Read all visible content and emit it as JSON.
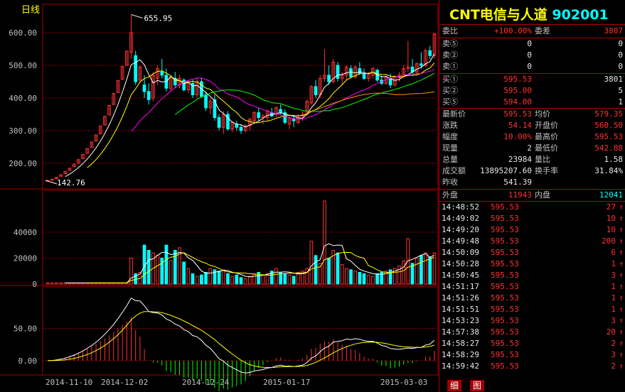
{
  "chart": {
    "period_label": "日线",
    "price_axis": [
      "600.00",
      "500.00",
      "400.00",
      "300.00",
      "200.00"
    ],
    "volume_axis": [
      "40000",
      "20000",
      "0"
    ],
    "macd_axis": [
      "50.00",
      "0.00"
    ],
    "high_marker": "655.95",
    "low_marker": "142.76",
    "dates": [
      "2014-11-10",
      "2014-12-02",
      "2014-12-24",
      "2015-01-17",
      "2015-03-03"
    ],
    "colors": {
      "up": "#ff3232",
      "down": "#00ffff",
      "grid": "#a00000",
      "ma5": "#ffffff",
      "ma10": "#ffff00",
      "ma20": "#ff00ff",
      "ma30": "#00ff00",
      "ma60": "#ff8c00"
    }
  },
  "chart_data": {
    "type": "candlestick",
    "price_ylim": [
      130,
      670
    ],
    "volume_ylim": [
      0,
      70000
    ],
    "macd_ylim": [
      -20,
      110
    ],
    "candles": [
      [
        145,
        148,
        143,
        147
      ],
      [
        148,
        152,
        146,
        151
      ],
      [
        153,
        158,
        151,
        157
      ],
      [
        160,
        166,
        158,
        165
      ],
      [
        168,
        176,
        167,
        175
      ],
      [
        178,
        186,
        177,
        185
      ],
      [
        189,
        198,
        188,
        197
      ],
      [
        200,
        212,
        199,
        211
      ],
      [
        214,
        228,
        213,
        227
      ],
      [
        230,
        246,
        229,
        245
      ],
      [
        248,
        266,
        247,
        265
      ],
      [
        268,
        288,
        267,
        287
      ],
      [
        290,
        315,
        289,
        314
      ],
      [
        317,
        345,
        316,
        344
      ],
      [
        348,
        378,
        347,
        377
      ],
      [
        380,
        415,
        379,
        414
      ],
      [
        417,
        455,
        416,
        454
      ],
      [
        457,
        498,
        456,
        497
      ],
      [
        500,
        545,
        499,
        544
      ],
      [
        540,
        656,
        520,
        600
      ],
      [
        530,
        545,
        440,
        450
      ],
      [
        455,
        500,
        450,
        495
      ],
      [
        440,
        470,
        400,
        420
      ],
      [
        420,
        445,
        380,
        395
      ],
      [
        400,
        480,
        390,
        470
      ],
      [
        460,
        500,
        440,
        490
      ],
      [
        480,
        520,
        460,
        470
      ],
      [
        470,
        490,
        420,
        430
      ],
      [
        430,
        470,
        420,
        465
      ],
      [
        460,
        480,
        430,
        440
      ],
      [
        440,
        470,
        430,
        460
      ],
      [
        455,
        460,
        420,
        425
      ],
      [
        425,
        455,
        415,
        450
      ],
      [
        445,
        455,
        400,
        410
      ],
      [
        410,
        460,
        400,
        450
      ],
      [
        450,
        460,
        400,
        405
      ],
      [
        410,
        420,
        360,
        370
      ],
      [
        370,
        400,
        350,
        390
      ],
      [
        395,
        410,
        330,
        340
      ],
      [
        340,
        350,
        300,
        310
      ],
      [
        310,
        360,
        290,
        350
      ],
      [
        350,
        360,
        300,
        305
      ],
      [
        305,
        330,
        295,
        325
      ],
      [
        320,
        330,
        300,
        310
      ],
      [
        310,
        320,
        290,
        300
      ],
      [
        300,
        320,
        295,
        315
      ],
      [
        315,
        340,
        300,
        335
      ],
      [
        330,
        360,
        320,
        355
      ],
      [
        355,
        370,
        330,
        340
      ],
      [
        340,
        350,
        320,
        345
      ],
      [
        340,
        365,
        330,
        360
      ],
      [
        355,
        370,
        340,
        345
      ],
      [
        350,
        375,
        340,
        370
      ],
      [
        365,
        380,
        350,
        355
      ],
      [
        355,
        365,
        320,
        325
      ],
      [
        320,
        345,
        305,
        340
      ],
      [
        335,
        345,
        310,
        330
      ],
      [
        325,
        350,
        320,
        345
      ],
      [
        345,
        360,
        330,
        350
      ],
      [
        350,
        395,
        345,
        390
      ],
      [
        385,
        440,
        380,
        435
      ],
      [
        435,
        455,
        400,
        410
      ],
      [
        410,
        470,
        400,
        460
      ],
      [
        460,
        550,
        450,
        470
      ],
      [
        470,
        500,
        440,
        450
      ],
      [
        450,
        520,
        445,
        510
      ],
      [
        500,
        510,
        450,
        460
      ],
      [
        460,
        480,
        440,
        470
      ],
      [
        470,
        500,
        455,
        495
      ],
      [
        490,
        500,
        460,
        465
      ],
      [
        465,
        500,
        460,
        495
      ],
      [
        490,
        510,
        470,
        475
      ],
      [
        475,
        490,
        455,
        460
      ],
      [
        460,
        480,
        450,
        475
      ],
      [
        470,
        495,
        460,
        490
      ],
      [
        485,
        490,
        450,
        455
      ],
      [
        455,
        470,
        440,
        445
      ],
      [
        445,
        470,
        440,
        465
      ],
      [
        460,
        475,
        430,
        440
      ],
      [
        440,
        470,
        435,
        465
      ],
      [
        465,
        480,
        450,
        470
      ],
      [
        470,
        500,
        460,
        490
      ],
      [
        490,
        575,
        480,
        495
      ],
      [
        495,
        520,
        470,
        480
      ],
      [
        480,
        510,
        470,
        505
      ],
      [
        505,
        540,
        490,
        500
      ],
      [
        500,
        550,
        495,
        545
      ],
      [
        545,
        560,
        520,
        530
      ],
      [
        530,
        600,
        520,
        596
      ]
    ],
    "volumes": [
      900,
      900,
      900,
      900,
      900,
      900,
      900,
      900,
      900,
      900,
      900,
      900,
      900,
      900,
      900,
      900,
      900,
      900,
      900,
      20000,
      8000,
      9000,
      30000,
      26000,
      24000,
      22000,
      20000,
      30000,
      18000,
      26000,
      28000,
      17000,
      12000,
      8000,
      6000,
      7000,
      9000,
      12000,
      11000,
      10000,
      11000,
      8000,
      6000,
      7000,
      5000,
      4000,
      6000,
      8000,
      9000,
      7000,
      8000,
      10000,
      12000,
      9000,
      8000,
      7000,
      6000,
      9000,
      10000,
      12000,
      33000,
      22000,
      16000,
      64000,
      20000,
      26000,
      24000,
      15000,
      12000,
      11000,
      10000,
      9000,
      8000,
      7000,
      6000,
      8000,
      9000,
      10000,
      11000,
      12000,
      14000,
      18000,
      35000,
      16000,
      20000,
      22000,
      24000,
      21000,
      24000
    ],
    "series_note": "candles are [open, high, low, close] per trading day"
  },
  "quote": {
    "stock_name": "CNT电信与人道",
    "stock_code": "902001",
    "weibi_label": "委比",
    "weibi_value": "+100.00%",
    "weicha_label": "委差",
    "weicha_value": "3807",
    "asks": [
      {
        "label": "卖⑤",
        "price": "0",
        "vol": "0"
      },
      {
        "label": "卖②",
        "price": "0",
        "vol": "0"
      },
      {
        "label": "卖①",
        "price": "0",
        "vol": "0"
      }
    ],
    "bids": [
      {
        "label": "买①",
        "price": "595.53",
        "vol": "3801"
      },
      {
        "label": "买②",
        "price": "595.00",
        "vol": "5"
      },
      {
        "label": "买⑤",
        "price": "594.00",
        "vol": "1"
      }
    ],
    "stats": [
      {
        "l1": "最新价",
        "v1": "595.53",
        "l2": "均价",
        "v2": "579.35"
      },
      {
        "l1": "涨跌",
        "v1": "54.14",
        "l2": "开盘价",
        "v2": "560.50"
      },
      {
        "l1": "幅度",
        "v1": "10.00%",
        "l2": "最高价",
        "v2": "595.53"
      },
      {
        "l1": "现量",
        "v1": "2",
        "l2": "最低价",
        "v2": "542.88"
      },
      {
        "l1": "总量",
        "v1": "23984",
        "l2": "量比",
        "v2": "1.58"
      },
      {
        "l1": "成交额",
        "v1": "13895207.60",
        "l2": "换手率",
        "v2": "31.84%"
      }
    ],
    "prev_close_label": "昨收",
    "prev_close_value": "541.39",
    "outer_label": "外盘",
    "outer_value": "11943",
    "inner_label": "内盘",
    "inner_value": "12041",
    "ticks": [
      {
        "time": "14:48:52",
        "price": "595.53",
        "vol": "27"
      },
      {
        "time": "14:49:02",
        "price": "595.53",
        "vol": "10"
      },
      {
        "time": "14:49:20",
        "price": "595.53",
        "vol": "10"
      },
      {
        "time": "14:49:48",
        "price": "595.53",
        "vol": "200"
      },
      {
        "time": "14:50:09",
        "price": "595.53",
        "vol": "6"
      },
      {
        "time": "14:50:28",
        "price": "595.53",
        "vol": "1"
      },
      {
        "time": "14:50:45",
        "price": "595.53",
        "vol": "3"
      },
      {
        "time": "14:51:17",
        "price": "595.53",
        "vol": "1"
      },
      {
        "time": "14:51:26",
        "price": "595.53",
        "vol": "1"
      },
      {
        "time": "14:51:51",
        "price": "595.53",
        "vol": "1"
      },
      {
        "time": "14:53:23",
        "price": "595.53",
        "vol": "3"
      },
      {
        "time": "14:57:38",
        "price": "595.53",
        "vol": "20"
      },
      {
        "time": "14:58:27",
        "price": "595.53",
        "vol": "2"
      },
      {
        "time": "14:58:29",
        "price": "595.53",
        "vol": "3"
      },
      {
        "time": "14:59:42",
        "price": "595.53",
        "vol": "2"
      }
    ],
    "tick_arrow": "↑",
    "tabs": [
      "细",
      "图"
    ]
  }
}
